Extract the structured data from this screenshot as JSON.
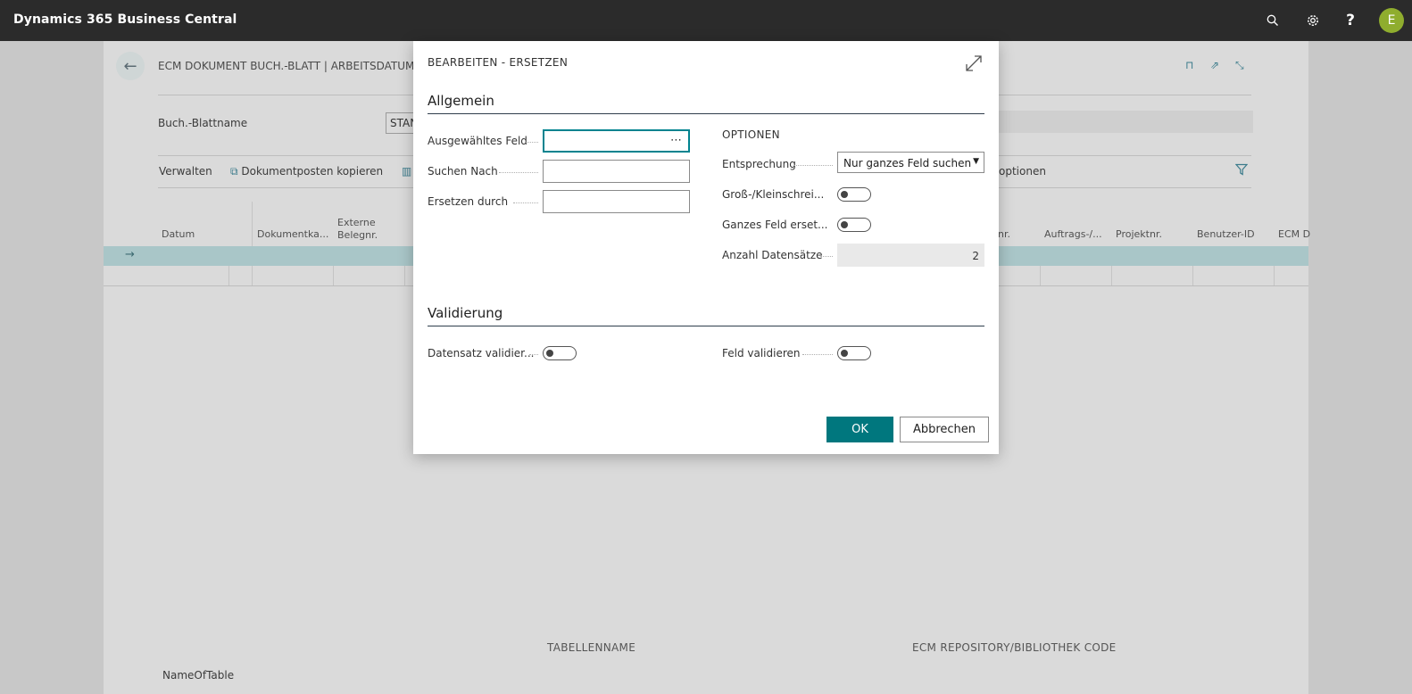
{
  "app": {
    "title": "Dynamics 365 Business Central",
    "avatar_letter": "E"
  },
  "topbar_icons": [
    "search-icon",
    "gear-icon",
    "help-icon"
  ],
  "background_page": {
    "title": "ECM DOKUMENT BUCH.-BLATT | ARBEITSDATUM: 2",
    "batch_label": "Buch.-Blattname",
    "batch_value": "STAN",
    "actions": {
      "manage": "Verwalten",
      "copy": "Dokumentposten kopieren",
      "options": "optionen"
    },
    "columns": [
      "Datum",
      "Dokumentka...",
      "Externe Belegnr.",
      "nr.",
      "Auftrags-/...",
      "Projektnr.",
      "Benutzer-ID",
      "ECM D"
    ],
    "factbox": {
      "table_name_header": "TABELLENNAME",
      "repo_header": "ECM REPOSITORY/BIBLIOTHEK CODE",
      "name_of_table": "NameOfTable"
    }
  },
  "dialog": {
    "title": "BEARBEITEN - ERSETZEN",
    "general": {
      "title": "Allgemein",
      "selected_field_label": "Ausgewähltes Feld",
      "selected_field_value": "",
      "search_label": "Suchen Nach",
      "search_value": "",
      "replace_label": "Ersetzen durch",
      "replace_value": "",
      "options_title": "OPTIONEN",
      "match_label": "Entsprechung",
      "match_value": "Nur ganzes Feld suchen",
      "case_label": "Groß-/Kleinschrei...",
      "case_on": false,
      "whole_field_label": "Ganzes Feld erset...",
      "whole_field_on": false,
      "record_count_label": "Anzahl Datensätze",
      "record_count_value": "2"
    },
    "validation": {
      "title": "Validierung",
      "validate_record_label": "Datensatz validier...",
      "validate_record_on": false,
      "validate_field_label": "Feld validieren",
      "validate_field_on": false
    },
    "buttons": {
      "ok": "OK",
      "cancel": "Abbrechen"
    }
  },
  "colors": {
    "accent": "#00777e",
    "topbar": "#2b2b2b",
    "avatar": "#8fad2e",
    "selected_row": "#a9c6c8"
  }
}
